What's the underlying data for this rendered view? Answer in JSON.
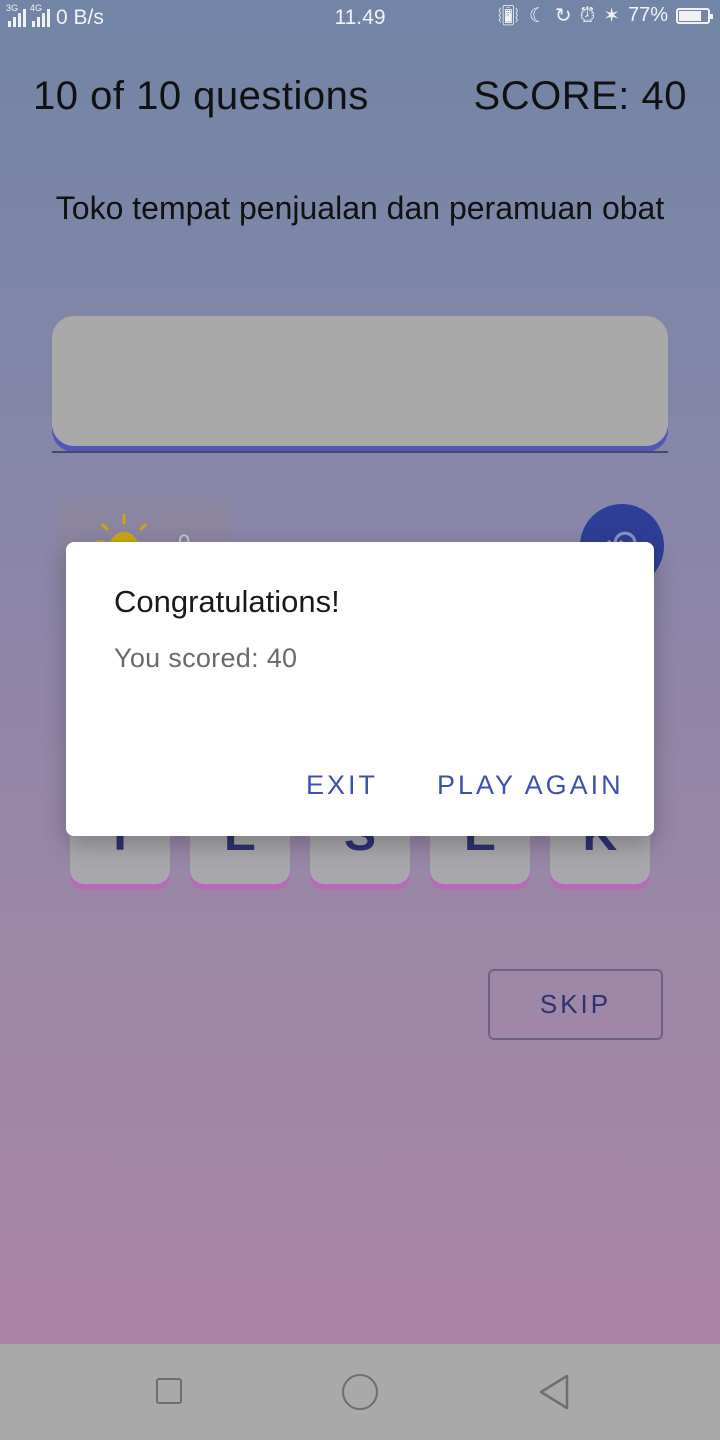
{
  "status_bar": {
    "network_left": "3G",
    "network_right": "4G",
    "data_rate": "0 B/s",
    "time": "11.49",
    "battery_percent": "77%",
    "battery_level": 0.77,
    "icons": [
      "vibrate-icon",
      "moon-icon",
      "lock-rotation-icon",
      "alarm-icon",
      "bluetooth-icon",
      "battery-icon"
    ]
  },
  "header": {
    "progress": "10 of 10 questions",
    "score": "SCORE: 40"
  },
  "question": {
    "text": "Toko tempat penjualan dan peramuan obat"
  },
  "answer_box": {
    "value": ""
  },
  "hint": {
    "icon": "lightbulb-icon",
    "count": "0"
  },
  "undo": {
    "icon": "undo-icon"
  },
  "letters": [
    "T",
    "E",
    "S",
    "E",
    "K"
  ],
  "skip_label": "SKIP",
  "dialog": {
    "title": "Congratulations!",
    "message": "You scored: 40",
    "exit_label": "EXIT",
    "play_again_label": "PLAY AGAIN"
  },
  "nav_bar": {
    "icons": [
      "recents-icon",
      "home-icon",
      "back-icon"
    ]
  },
  "colors": {
    "dialog_button": "#3f50b5",
    "undo_button": "#2e3e96",
    "answer_shadow": "#5256b8",
    "tile_shadow": "#b86bb4"
  }
}
